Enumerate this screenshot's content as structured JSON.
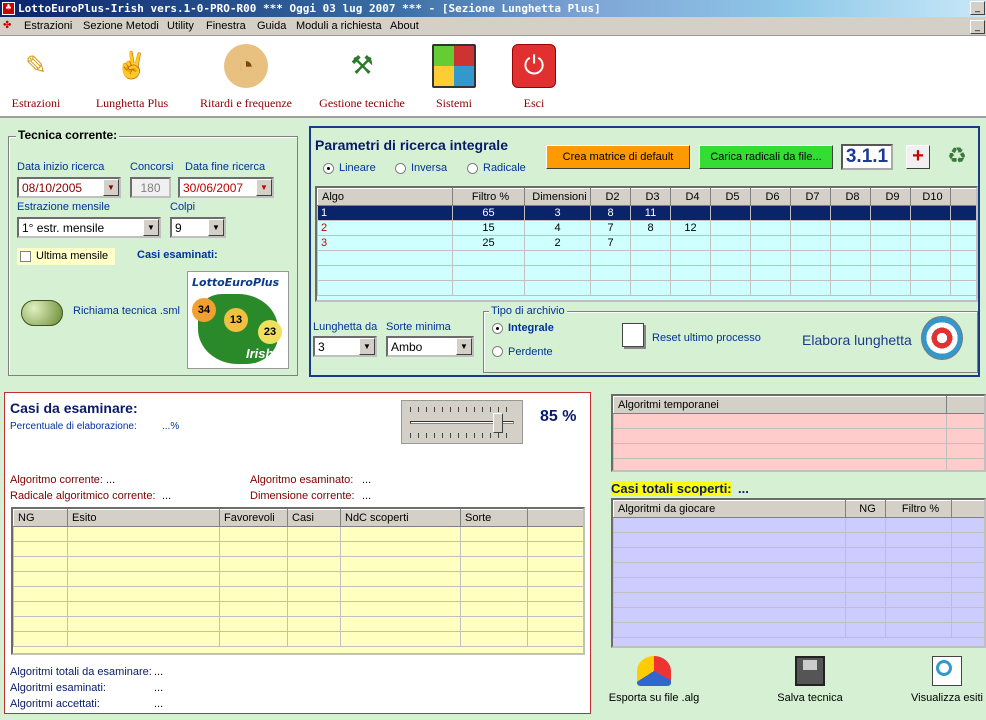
{
  "window": {
    "title": "LottoEuroPlus-Irish vers.1-0-PRO-R00  ***  Oggi 03 lug 2007  ***   - [Sezione Lunghetta Plus]"
  },
  "menu": [
    "Estrazioni",
    "Sezione Metodi",
    "Utility",
    "Finestra",
    "Guida",
    "Moduli a richiesta",
    "About"
  ],
  "toolbar": [
    {
      "label": "Estrazioni",
      "icon": "pencil-icon"
    },
    {
      "label": "Lunghetta Plus",
      "icon": "lottery-hand-icon"
    },
    {
      "label": "Ritardi e frequenze",
      "icon": "clock-icon"
    },
    {
      "label": "Gestione tecniche",
      "icon": "tools-icon"
    },
    {
      "label": "Sistemi",
      "icon": "grid-icon"
    },
    {
      "label": "Esci",
      "icon": "power-icon"
    }
  ],
  "tecnica": {
    "title": "Tecnica corrente:",
    "data_inizio_label": "Data inizio ricerca",
    "data_inizio": "08/10/2005",
    "concorsi_label": "Concorsi",
    "concorsi": "180",
    "data_fine_label": "Data fine ricerca",
    "data_fine": "30/06/2007",
    "estrazione_label": "Estrazione mensile",
    "estrazione": "1° estr. mensile",
    "colpi_label": "Colpi",
    "colpi": "9",
    "ultima_label": "Ultima mensile",
    "casi_label": "Casi esaminati:",
    "richiama_label": "Richiama tecnica .sml",
    "logo_text": "LottoEuroPlus",
    "logo_sub": "Irish",
    "logo_numbers": [
      "34",
      "13",
      "23"
    ]
  },
  "parametri": {
    "title": "Parametri di ricerca integrale",
    "radios": [
      "Lineare",
      "Inversa",
      "Radicale"
    ],
    "crea_btn": "Crea matrice di default",
    "carica_btn": "Carica radicali da file...",
    "version": "3.1.1",
    "columns": [
      "Algo",
      "Filtro %",
      "Dimensioni",
      "D2",
      "D3",
      "D4",
      "D5",
      "D6",
      "D7",
      "D8",
      "D9",
      "D10"
    ],
    "rows": [
      [
        "1",
        "65",
        "3",
        "8",
        "11",
        "",
        "",
        "",
        "",
        "",
        "",
        ""
      ],
      [
        "2",
        "15",
        "4",
        "7",
        "8",
        "12",
        "",
        "",
        "",
        "",
        "",
        ""
      ],
      [
        "3",
        "25",
        "2",
        "7",
        "",
        "",
        "",
        "",
        "",
        "",
        "",
        ""
      ]
    ],
    "lunghetta_label": "Lunghetta da",
    "lunghetta": "3",
    "sorte_label": "Sorte minima",
    "sorte": "Ambo",
    "archivio_label": "Tipo di archivio",
    "integrale": "Integrale",
    "perdente": "Perdente",
    "reset_label": "Reset ultimo processo",
    "elabora_label": "Elabora lunghetta"
  },
  "casi": {
    "title": "Casi da esaminare:",
    "percentuale_label": "Percentuale di elaborazione:",
    "percentuale": "...%",
    "slider_value": 0.85,
    "slider_pct": "85 %",
    "algo_corr_label": "Algoritmo corrente:",
    "algo_corr": "...",
    "algo_esam_label": "Algoritmo esaminato:",
    "algo_esam": "...",
    "radicale_label": "Radicale algoritmico corrente:",
    "radicale": "...",
    "dimensione_label": "Dimensione corrente:",
    "dimensione": "...",
    "columns": [
      "NG",
      "Esito",
      "Favorevoli",
      "Casi",
      "NdC scoperti",
      "Sorte"
    ],
    "totali_label": "Algoritmi totali da esaminare:",
    "totali": "...",
    "esaminati_label": "Algoritmi esaminati:",
    "esaminati": "...",
    "accettati_label": "Algoritmi accettati:",
    "accettati": "..."
  },
  "right": {
    "temp_header": "Algoritmi temporanei",
    "casi_totali_label": "Casi totali scoperti:",
    "casi_totali": "...",
    "gioc_columns": [
      "Algoritmi da giocare",
      "NG",
      "Filtro %"
    ],
    "esporta": "Esporta su file .alg",
    "salva": "Salva tecnica",
    "visualizza": "Visualizza esiti"
  }
}
